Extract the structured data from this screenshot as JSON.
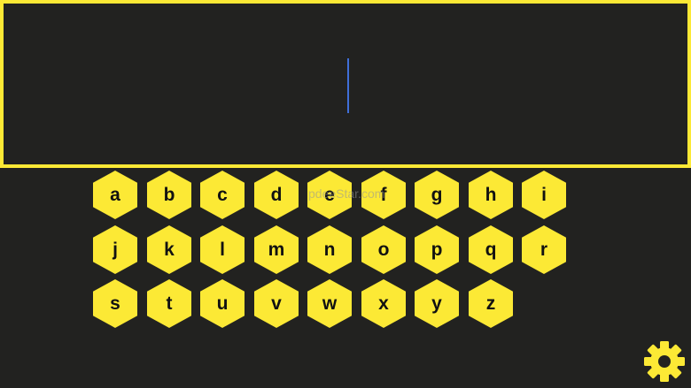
{
  "text_area": {
    "value": ""
  },
  "keyboard": {
    "rows": [
      [
        "a",
        "b",
        "c",
        "d",
        "e",
        "f",
        "g",
        "h",
        "i"
      ],
      [
        "j",
        "k",
        "l",
        "m",
        "n",
        "o",
        "p",
        "q",
        "r"
      ],
      [
        "s",
        "t",
        "u",
        "v",
        "w",
        "x",
        "y",
        "z"
      ]
    ]
  },
  "watermark": {
    "text": "pdeeStar.com"
  },
  "icons": {
    "settings": "gear-icon"
  },
  "colors": {
    "accent": "#fce935",
    "background": "#222220",
    "cursor": "#3f6fd8"
  }
}
